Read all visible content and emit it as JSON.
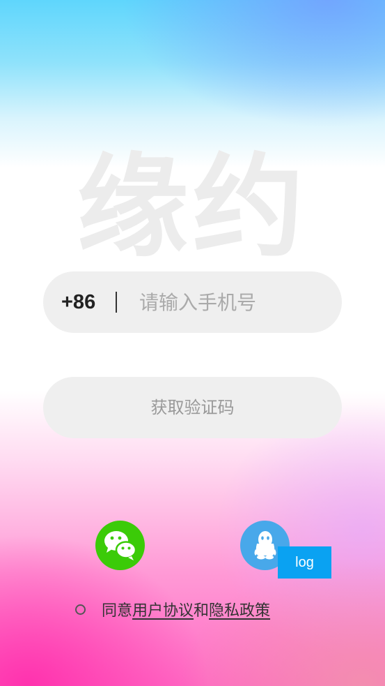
{
  "app": {
    "logo_text": "缘约"
  },
  "login": {
    "country_code": "+86",
    "phone_placeholder": "请输入手机号",
    "phone_value": "",
    "get_code_label": "获取验证码"
  },
  "social": {
    "wechat_icon": "wechat-icon",
    "qq_icon": "qq-icon",
    "wechat_color": "#3bcb08",
    "qq_color": "#48a8ea",
    "log_label": "log",
    "log_color": "#0aa2f2"
  },
  "agreement": {
    "prefix": "同意",
    "user_agreement": "用户协议",
    "conjunction": "和",
    "privacy_policy": "隐私政策",
    "checked": false
  }
}
